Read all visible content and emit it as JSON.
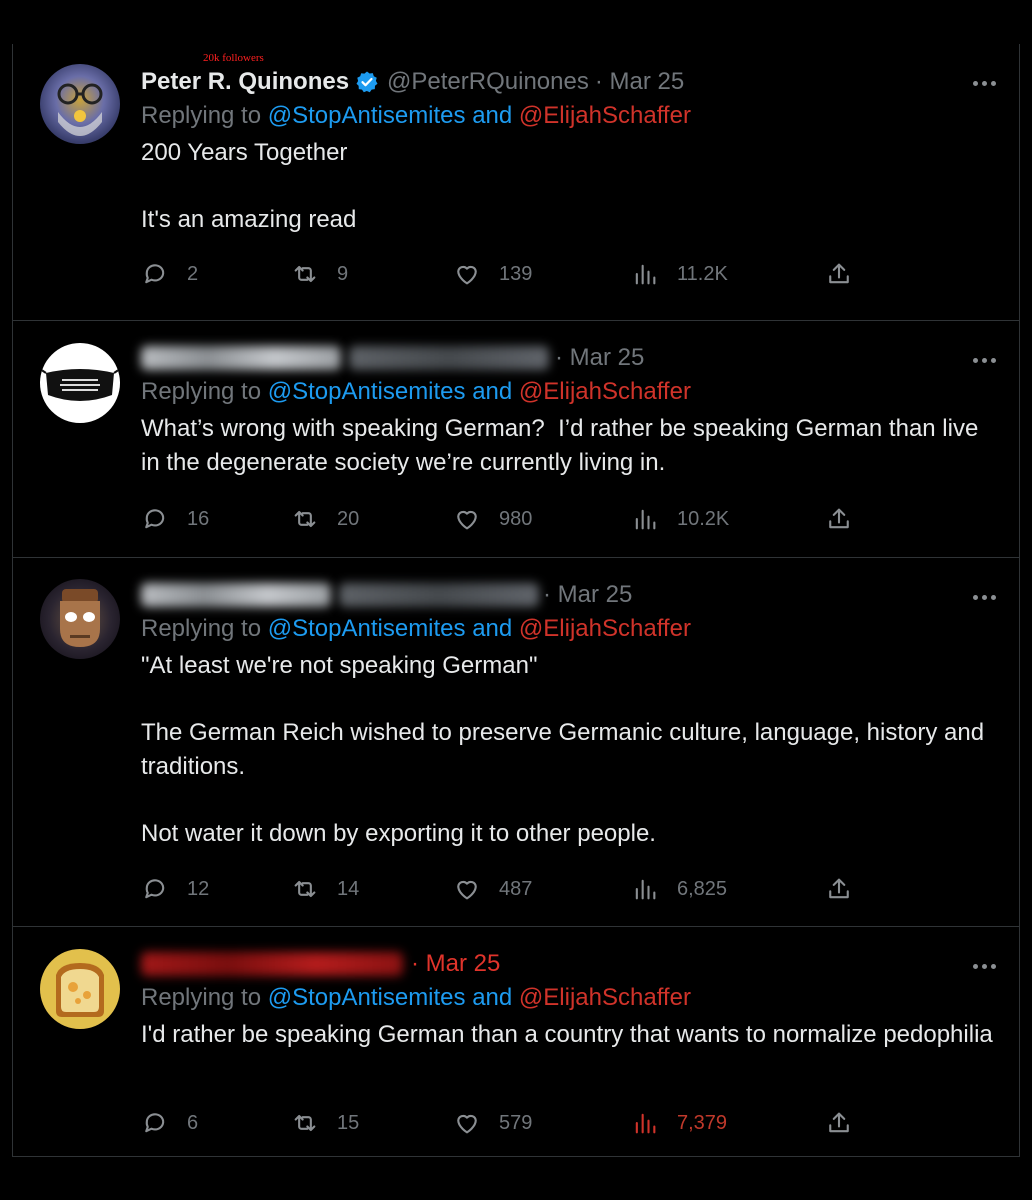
{
  "annotation": "20k followers",
  "reply_to": {
    "prefix": "Replying to ",
    "user1": "@StopAntisemites",
    "and": " and ",
    "user2": "@ElijahSchaffer"
  },
  "colors": {
    "background": "#000000",
    "text": "#e7e9ea",
    "muted": "#71767b",
    "link": "#1d9bf0",
    "highlight_red": "#e0342b",
    "verified": "#1d9bf0"
  },
  "tweets": [
    {
      "name": "Peter R. Quinones",
      "handle": "@PeterRQuinones",
      "date": "· Mar 25",
      "verified": true,
      "paragraphs": [
        "200 Years Together",
        "It's an amazing read"
      ],
      "stats": {
        "replies": "2",
        "retweets": "9",
        "likes": "139",
        "views": "11.2K"
      }
    },
    {
      "date": "· Mar 25",
      "avatar_text": "THIS MASK IS AS USELESS AS BIDEN'S BRAIN",
      "paragraphs": [
        "What’s wrong with speaking German?  I’d rather be speaking German than live in the degenerate society we’re currently living in."
      ],
      "stats": {
        "replies": "16",
        "retweets": "20",
        "likes": "980",
        "views": "10.2K"
      }
    },
    {
      "date": "· Mar 25",
      "paragraphs": [
        "\"At least we're not speaking German\"",
        "The German Reich wished to preserve Germanic culture, language, history and traditions.",
        "Not water it down by exporting it to other people."
      ],
      "stats": {
        "replies": "12",
        "retweets": "14",
        "likes": "487",
        "views": "6,825"
      }
    },
    {
      "date": "· Mar 25",
      "paragraphs": [
        "I'd rather be speaking German than a country that wants to normalize pedophilia"
      ],
      "stats": {
        "replies": "6",
        "retweets": "15",
        "likes": "579",
        "views": "7,379"
      }
    }
  ],
  "icons": [
    "reply-icon",
    "retweet-icon",
    "like-icon",
    "views-icon",
    "share-icon",
    "more-icon",
    "verified-badge-icon"
  ]
}
